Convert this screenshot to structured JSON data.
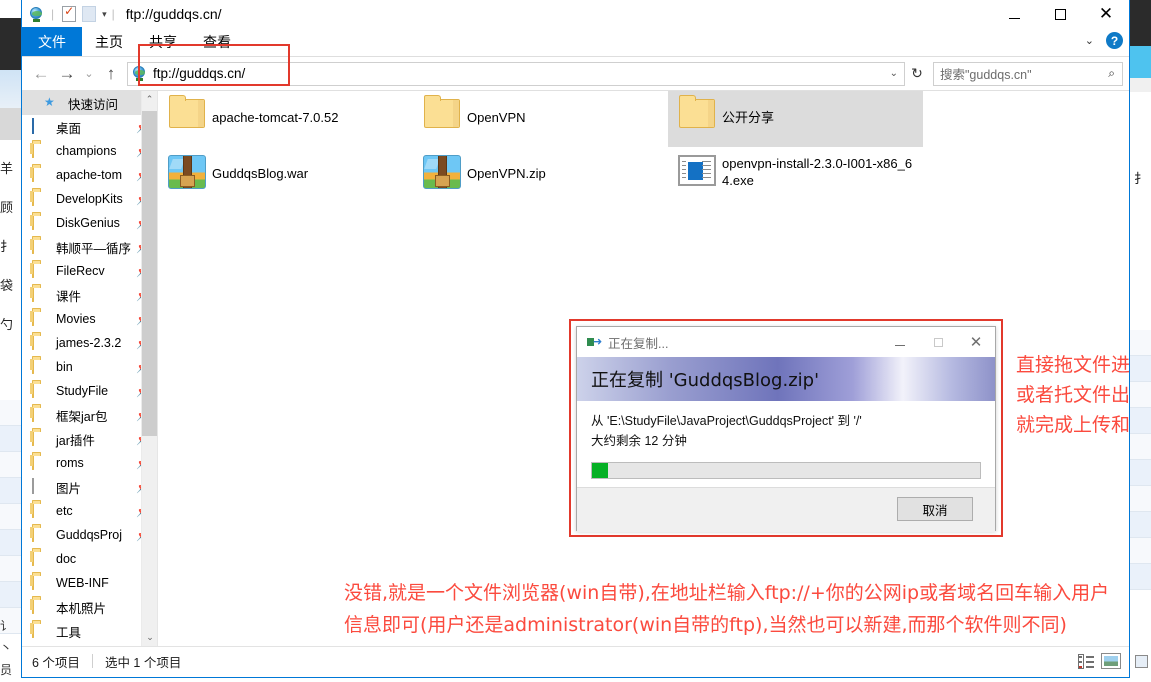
{
  "window": {
    "title": "ftp://guddqs.cn/",
    "quick_access_toolbar": [
      {
        "icon": "globe-icon",
        "name": "ftp-site-icon"
      },
      {
        "icon": "properties-icon",
        "name": "properties-button"
      },
      {
        "icon": "new-folder-icon",
        "name": "new-folder-button"
      },
      {
        "icon": "chevron-down-icon",
        "name": "customize-qat-button"
      }
    ],
    "controls": {
      "minimize": "—",
      "maximize": "☐",
      "close": "✕"
    }
  },
  "ribbon": {
    "tabs": [
      {
        "label": "文件",
        "active": true
      },
      {
        "label": "主页",
        "active": false
      },
      {
        "label": "共享",
        "active": false
      },
      {
        "label": "查看",
        "active": false
      }
    ],
    "collapse_icon": "chevron-down-icon",
    "help_label": "?"
  },
  "addressbar": {
    "back": "←",
    "forward": "→",
    "recent": "⌄",
    "up": "↑",
    "path": "ftp://guddqs.cn/",
    "dropdown_icon": "chevron-down-icon",
    "refresh_icon": "refresh-icon",
    "refresh_glyph": "↻"
  },
  "search": {
    "placeholder": "搜索\"guddqs.cn\"",
    "icon": "search-icon"
  },
  "navpane": {
    "items": [
      {
        "label": "快速访问",
        "icon": "star-icon",
        "pinned": false,
        "header": true
      },
      {
        "label": "桌面",
        "icon": "desktop-icon",
        "pinned": true
      },
      {
        "label": "champions",
        "icon": "folder-icon",
        "pinned": true
      },
      {
        "label": "apache-tom",
        "icon": "folder-icon",
        "pinned": true
      },
      {
        "label": "DevelopKits",
        "icon": "folder-icon",
        "pinned": true
      },
      {
        "label": "DiskGenius",
        "icon": "folder-icon",
        "pinned": true
      },
      {
        "label": "韩顺平—循序",
        "icon": "folder-icon",
        "pinned": true
      },
      {
        "label": "FileRecv",
        "icon": "folder-icon",
        "pinned": true
      },
      {
        "label": "课件",
        "icon": "folder-icon",
        "pinned": true
      },
      {
        "label": "Movies",
        "icon": "folder-icon",
        "pinned": true
      },
      {
        "label": "james-2.3.2",
        "icon": "folder-icon",
        "pinned": true
      },
      {
        "label": "bin",
        "icon": "folder-icon",
        "pinned": true
      },
      {
        "label": "StudyFile",
        "icon": "folder-icon",
        "pinned": true
      },
      {
        "label": "框架jar包",
        "icon": "folder-icon",
        "pinned": true
      },
      {
        "label": "jar插件",
        "icon": "folder-icon",
        "pinned": true
      },
      {
        "label": "roms",
        "icon": "folder-icon",
        "pinned": true
      },
      {
        "label": "图片",
        "icon": "pictures-icon",
        "pinned": true
      },
      {
        "label": "etc",
        "icon": "folder-icon",
        "pinned": true
      },
      {
        "label": "GuddqsProj",
        "icon": "folder-icon",
        "pinned": true
      },
      {
        "label": "doc",
        "icon": "folder-icon",
        "pinned": false
      },
      {
        "label": "WEB-INF",
        "icon": "folder-icon",
        "pinned": false
      },
      {
        "label": "本机照片",
        "icon": "folder-icon",
        "pinned": false
      },
      {
        "label": "工具",
        "icon": "folder-icon",
        "pinned": false
      }
    ]
  },
  "files": [
    {
      "name": "apache-tomcat-7.0.52",
      "icon": "folder-icon",
      "selected": false
    },
    {
      "name": "OpenVPN",
      "icon": "folder-icon",
      "selected": false
    },
    {
      "name": "公开分享",
      "icon": "folder-icon",
      "selected": true
    },
    {
      "name": "GuddqsBlog.war",
      "icon": "zip-archive-icon",
      "selected": false
    },
    {
      "name": "OpenVPN.zip",
      "icon": "zip-archive-icon",
      "selected": false
    },
    {
      "name": "openvpn-install-2.3.0-I001-x86_64.exe",
      "icon": "executable-icon",
      "selected": false
    }
  ],
  "dialog": {
    "titlebar_text": "正在复制...",
    "titlebar_icon": "copy-icon",
    "controls": {
      "minimize": "—",
      "maximize": "☐",
      "close": "✕"
    },
    "heading": "正在复制 'GuddqsBlog.zip'",
    "from_to": "从 'E:\\StudyFile\\JavaProject\\GuddqsProject' 到 '/'",
    "time_remaining": "大约剩余 12 分钟",
    "progress_percent": 4,
    "cancel_label": "取消"
  },
  "annotations": {
    "right": "直接拖文件进来\n或者托文件出去\n就完成上传和下载",
    "bottom": "没错,就是一个文件浏览器(win自带),在地址栏输入ftp://+你的公网ip或者域名回车输入用户\n信息即可(用户还是administrator(win自带的ftp),当然也可以新建,而那个软件则不同)",
    "color": "#fb4a3e"
  },
  "statusbar": {
    "item_count": "6 个项目",
    "selection": "选中 1 个项目",
    "view_details_icon": "details-view-icon",
    "view_tiles_icon": "large-icons-view-icon"
  },
  "colors": {
    "accent": "#0078d7",
    "annotation": "#fb4a3e",
    "progress": "#06b025",
    "selection": "#dcdcdc"
  }
}
